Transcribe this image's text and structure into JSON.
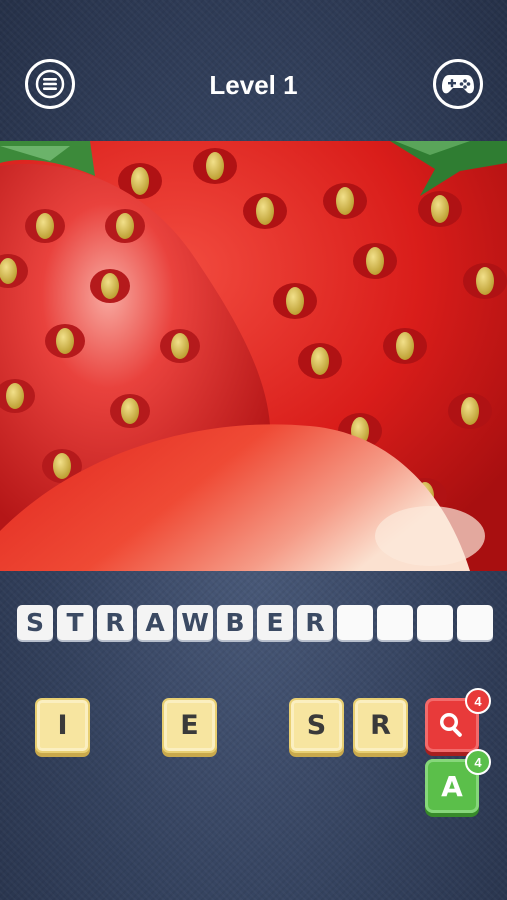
{
  "header": {
    "title": "Level 1",
    "menu_icon": "menu-icon",
    "games_icon": "gamepad-icon"
  },
  "puzzle": {
    "image_subject": "strawberries",
    "answer_slots": [
      "S",
      "T",
      "R",
      "A",
      "W",
      "B",
      "E",
      "R",
      "",
      "",
      "",
      ""
    ]
  },
  "letter_tiles": [
    {
      "letter": "I"
    },
    {
      "letter": "E"
    },
    {
      "letter": "S"
    },
    {
      "letter": "R"
    }
  ],
  "hints": {
    "reveal_search": {
      "icon": "magnifier-icon",
      "count": "4",
      "color": "#e83a3a"
    },
    "reveal_letter": {
      "glyph": "A",
      "count": "4",
      "color": "#5bbf4a"
    }
  },
  "colors": {
    "background": "#33415d",
    "tile": "#f7e5a0",
    "slot": "#f4f4f4"
  }
}
